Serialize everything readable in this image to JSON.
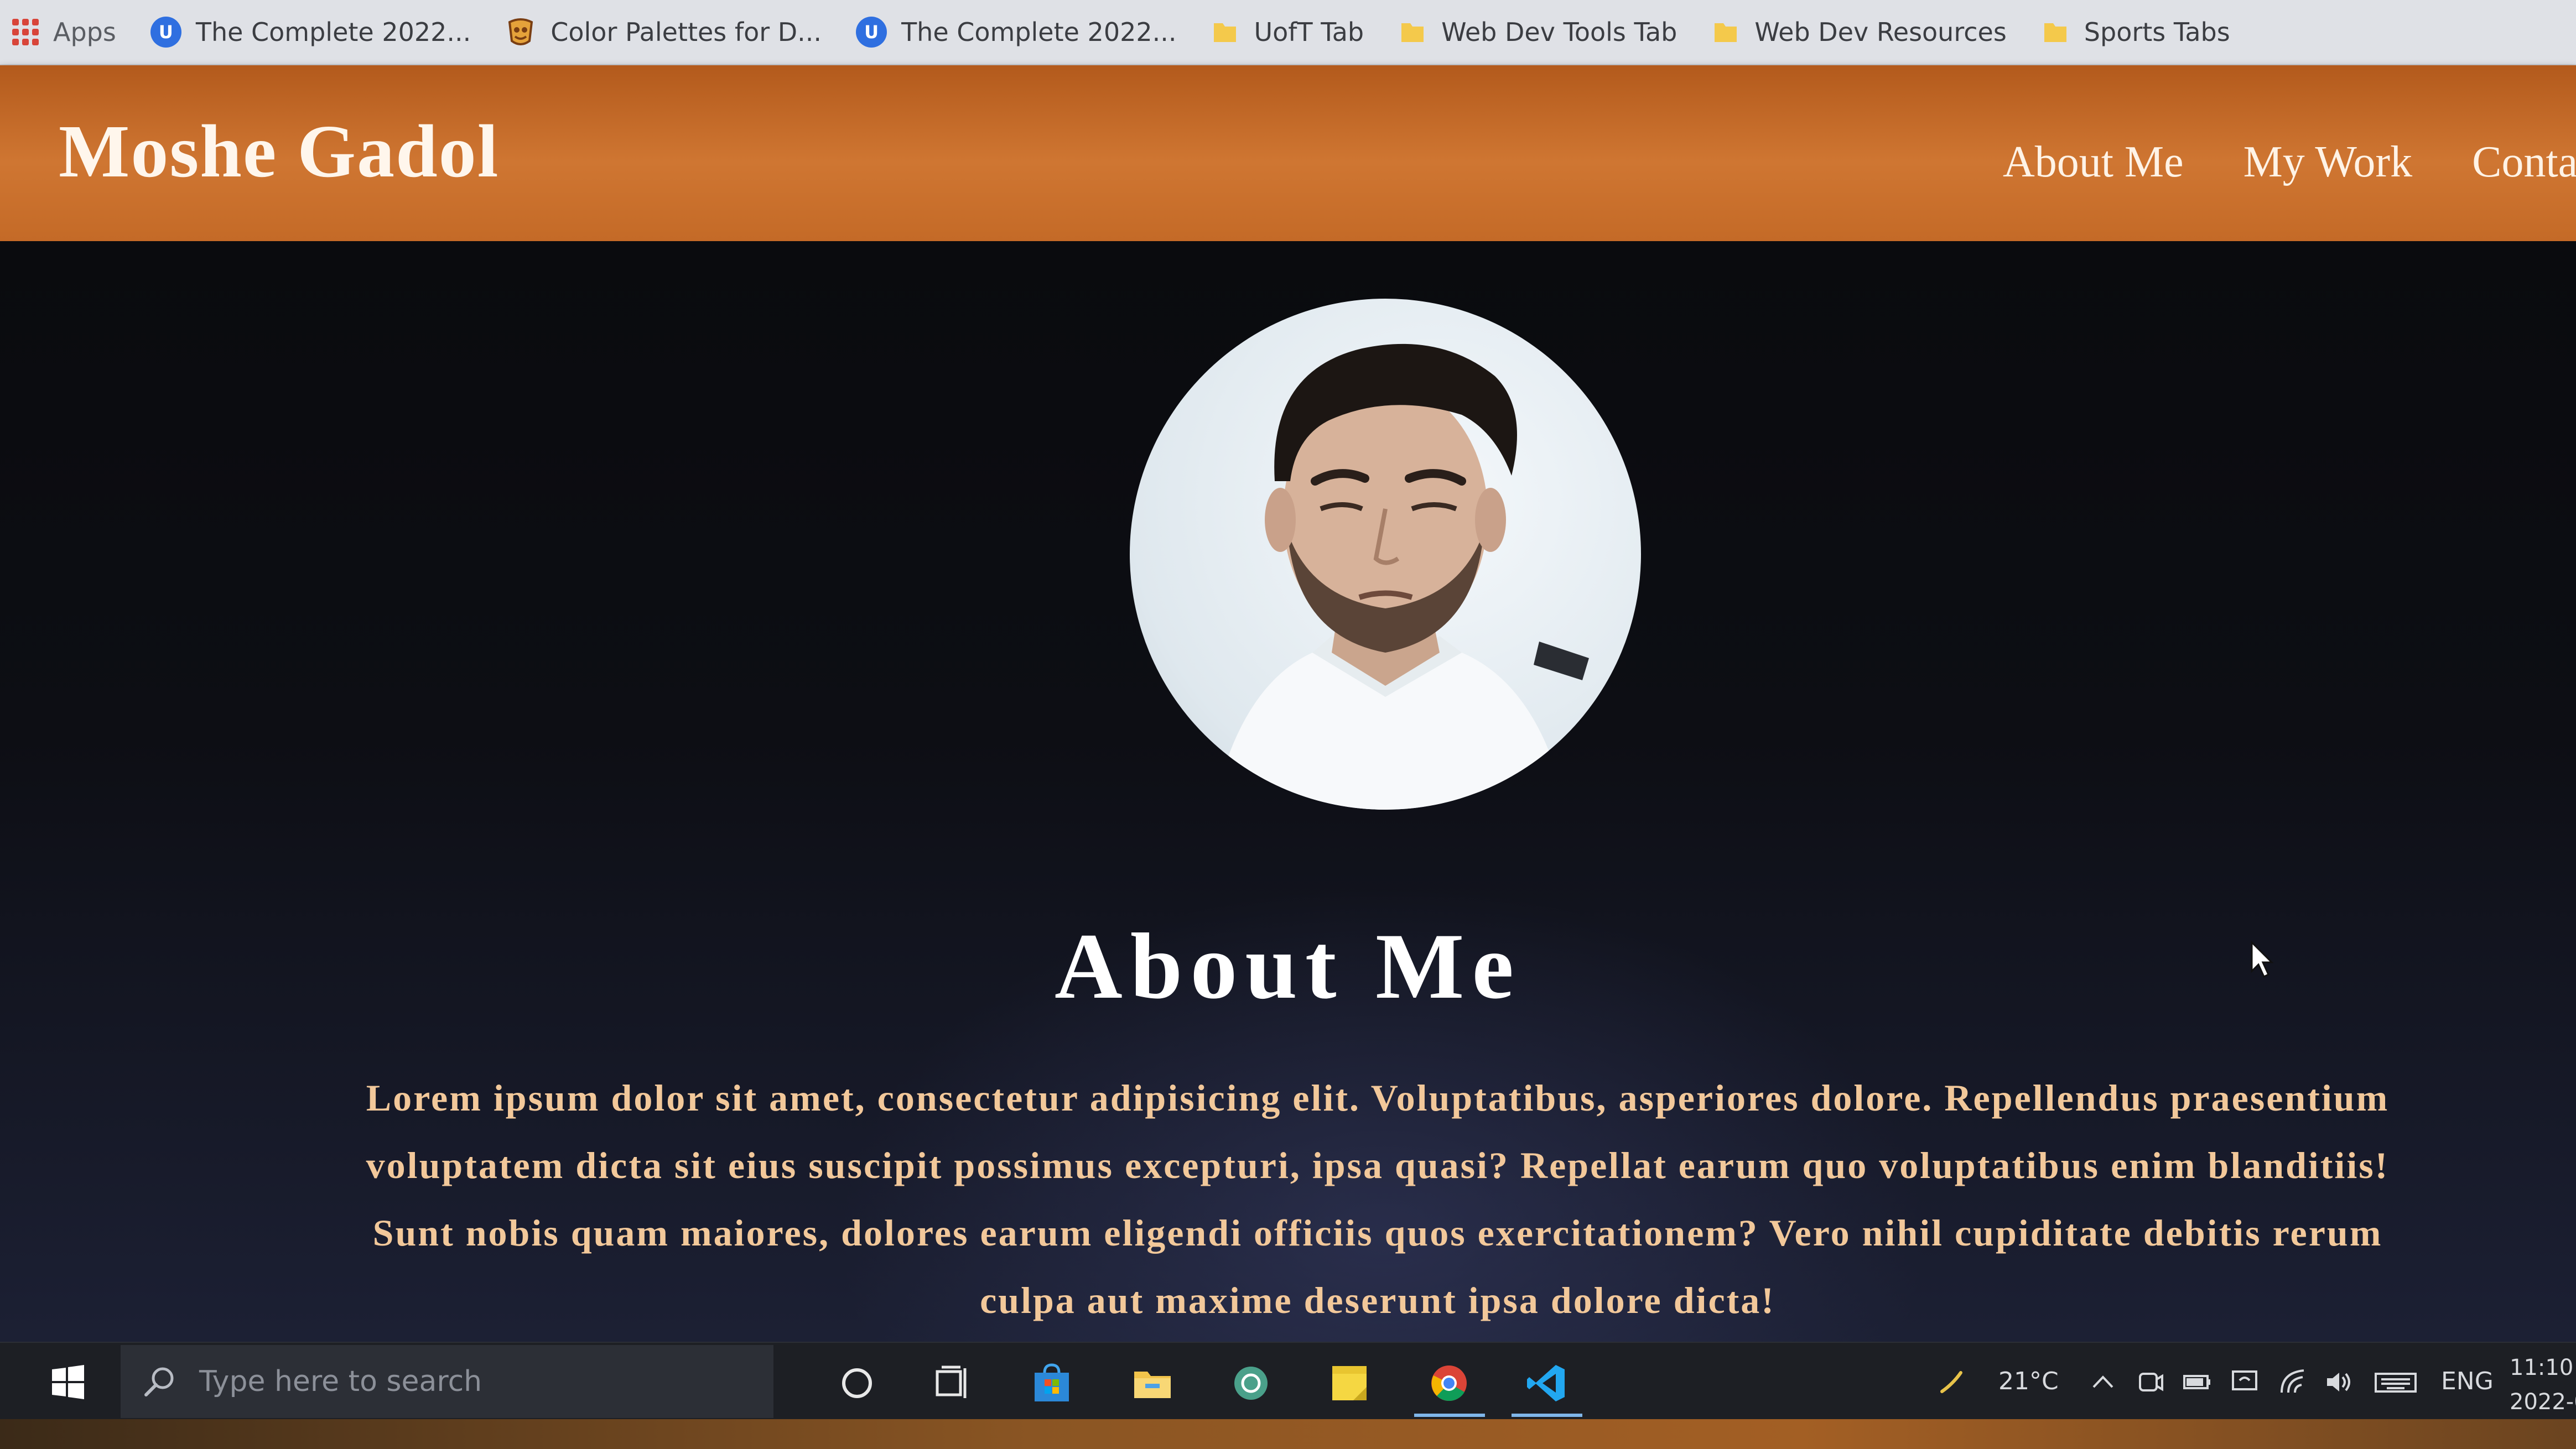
{
  "bookmarks": {
    "apps_label": "Apps",
    "items": [
      {
        "label": "The Complete 2022...",
        "icon": "udemy-icon"
      },
      {
        "label": "Color Palettes for D...",
        "icon": "palette-icon"
      },
      {
        "label": "The Complete 2022...",
        "icon": "udemy-icon"
      },
      {
        "label": "UofT Tab",
        "icon": "folder-icon"
      },
      {
        "label": "Web Dev Tools Tab",
        "icon": "folder-icon"
      },
      {
        "label": "Web Dev Resources",
        "icon": "folder-icon"
      },
      {
        "label": "Sports Tabs",
        "icon": "folder-icon"
      }
    ]
  },
  "site": {
    "title": "Moshe Gadol",
    "nav": [
      "About Me",
      "My Work",
      "Contac"
    ]
  },
  "about": {
    "heading": "About Me",
    "body": "Lorem ipsum dolor sit amet, consectetur adipisicing elit. Voluptatibus, asperiores dolore. Repellendus praesentium voluptatem dicta sit eius suscipit possimus excepturi, ipsa quasi? Repellat earum quo voluptatibus enim blanditiis! Sunt nobis quam maiores, dolores earum eligendi officiis quos exercitationem? Vero nihil cupiditate debitis rerum culpa aut maxime deserunt ipsa dolore dicta!"
  },
  "taskbar": {
    "search_placeholder": "Type here to search",
    "weather": "21°C",
    "language": "ENG",
    "time": "11:10",
    "date": "2022-0"
  },
  "colors": {
    "header_orange": "#c96d2b",
    "bio_text": "#f2c89a",
    "background": "#0c0c10"
  }
}
